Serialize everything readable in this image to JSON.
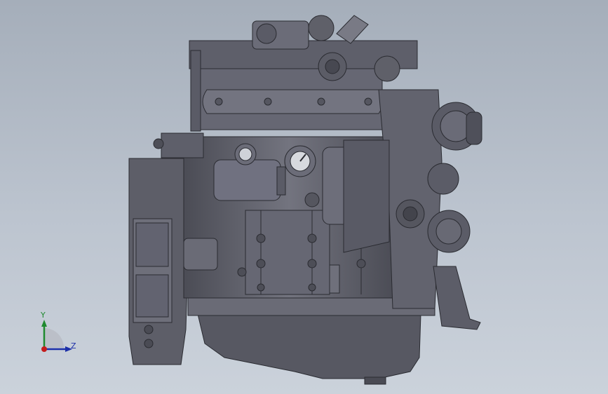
{
  "viewport": {
    "background_top": "#a5aeba",
    "background_bottom": "#cbd2db"
  },
  "model": {
    "body_color": "#5f606b",
    "dark_color": "#3e3f48",
    "light_color": "#7b7d88",
    "edge_color": "#2a2b31"
  },
  "triad": {
    "y_label": "Y",
    "z_label": "Z",
    "y_color": "#1f8a2f",
    "z_color": "#1c2fa8",
    "x_color": "#c41c1c"
  }
}
